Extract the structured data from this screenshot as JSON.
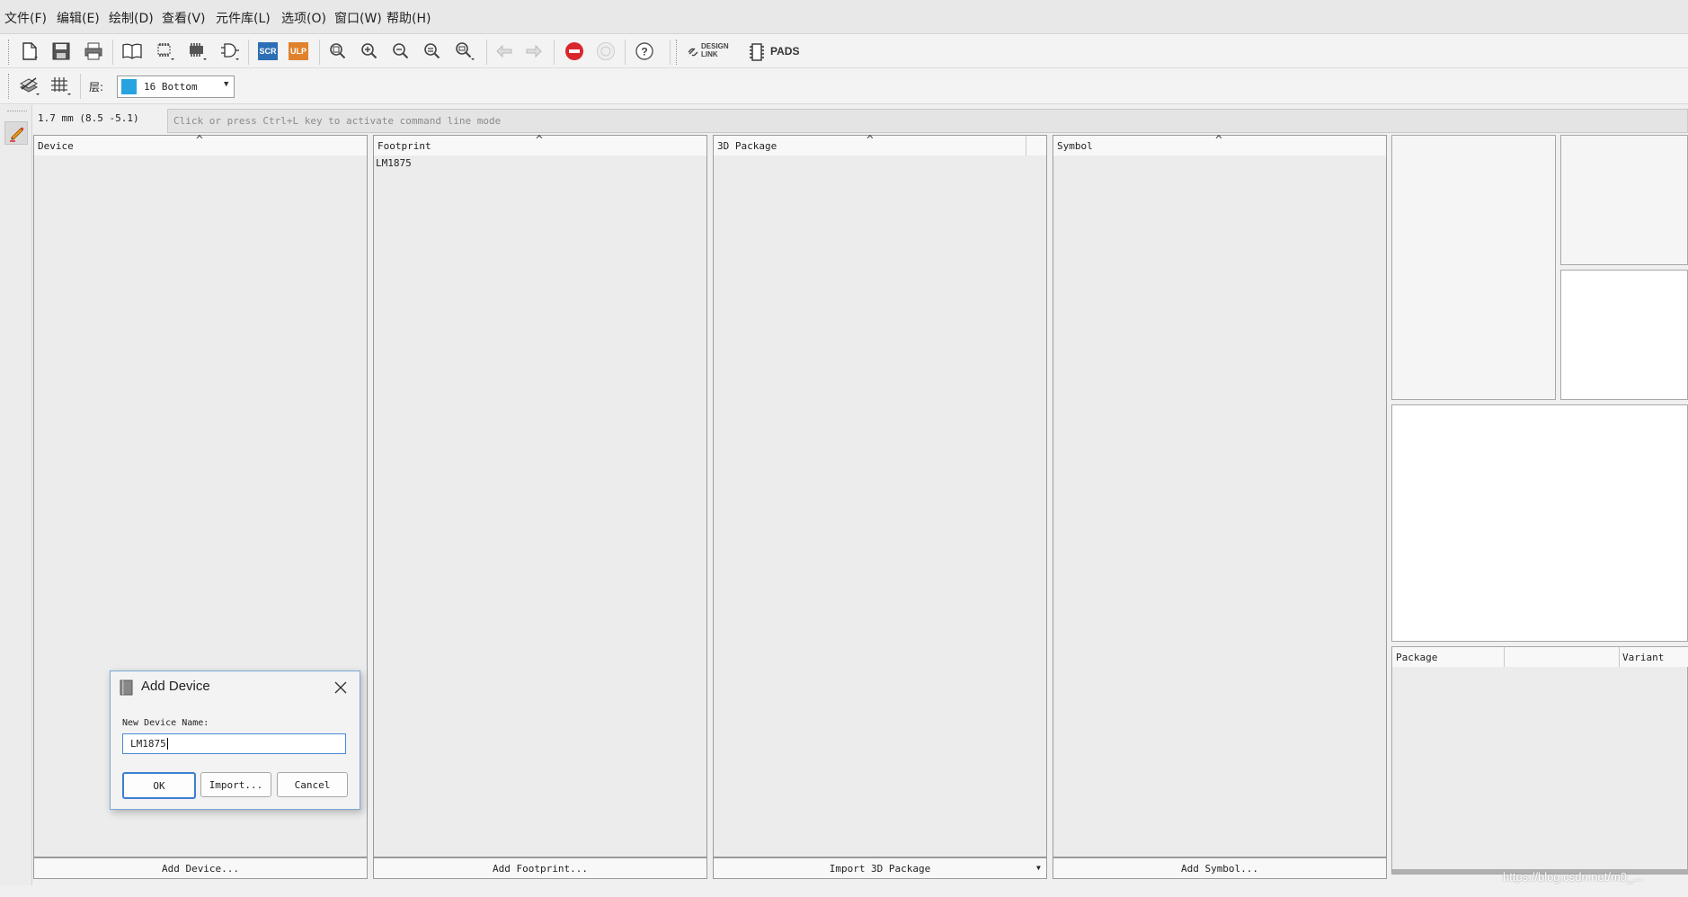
{
  "menu": [
    "文件(F)",
    "编辑(E)",
    "绘制(D)",
    "查看(V)",
    "元件库(L)",
    "选项(O)",
    "窗口(W)",
    "帮助(H)"
  ],
  "toolbar": {
    "scr_label": "SCR",
    "ulp_label": "ULP",
    "design_link_line1": "DESIGN",
    "design_link_line2": "LINK",
    "pads_label": "PADS"
  },
  "layer_bar": {
    "layer_label": "层:",
    "selected_layer": "16 Bottom",
    "layer_color": "#29a3e0"
  },
  "status": {
    "coordinates": "1.7 mm (8.5 -5.1)",
    "command_placeholder": "Click or press Ctrl+L key to activate command line mode"
  },
  "panels": {
    "device": {
      "title": "Device",
      "button": "Add Device..."
    },
    "footprint": {
      "title": "Footprint",
      "items": [
        "LM1875"
      ],
      "button": "Add Footprint..."
    },
    "package3d": {
      "title": "3D Package",
      "button": "Import 3D Package"
    },
    "symbol": {
      "title": "Symbol",
      "button": "Add Symbol..."
    }
  },
  "package_table": {
    "col_package": "Package",
    "col_variant": "Variant"
  },
  "dialog": {
    "title": "Add Device",
    "field_label": "New Device Name:",
    "field_value": "LM1875",
    "ok": "OK",
    "import": "Import...",
    "cancel": "Cancel"
  },
  "watermark": "https://blog.csdn.net/m0_..."
}
